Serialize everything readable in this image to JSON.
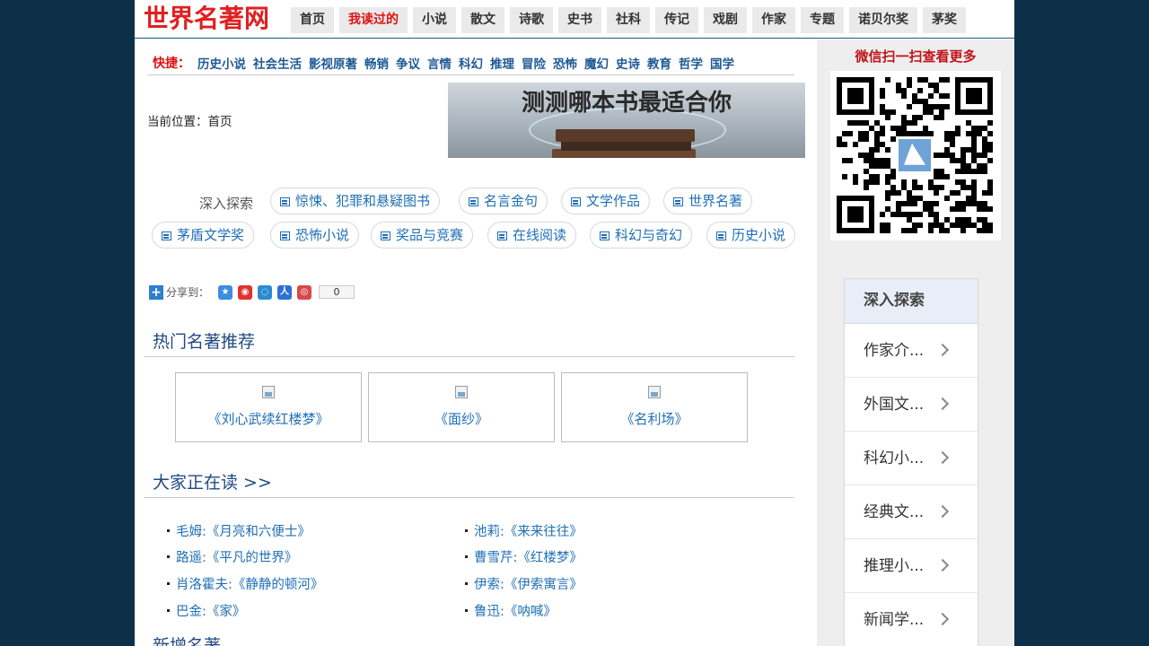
{
  "header": {
    "logo": "世界名著网",
    "nav": [
      {
        "label": "首页",
        "active": false
      },
      {
        "label": "我读过的",
        "active": true
      },
      {
        "label": "小说",
        "active": false
      },
      {
        "label": "散文",
        "active": false
      },
      {
        "label": "诗歌",
        "active": false
      },
      {
        "label": "史书",
        "active": false
      },
      {
        "label": "社科",
        "active": false
      },
      {
        "label": "传记",
        "active": false
      },
      {
        "label": "戏剧",
        "active": false
      },
      {
        "label": "作家",
        "active": false
      },
      {
        "label": "专题",
        "active": false
      },
      {
        "label": "诺贝尔奖",
        "active": false
      },
      {
        "label": "茅奖",
        "active": false
      }
    ]
  },
  "quick": {
    "label": "快捷：",
    "links": [
      "历史小说",
      "社会生活",
      "影视原著",
      "畅销",
      "争议",
      "言情",
      "科幻",
      "推理",
      "冒险",
      "恐怖",
      "魔幻",
      "史诗",
      "教育",
      "哲学",
      "国学"
    ]
  },
  "breadcrumb": "当前位置：首页",
  "banner": {
    "text": "测测哪本书最适合你"
  },
  "explore": {
    "label": "深入探索",
    "row1": [
      "惊悚、犯罪和悬疑图书",
      "名言金句",
      "文学作品",
      "世界名著"
    ],
    "row2": [
      "茅盾文学奖",
      "恐怖小说",
      "奖品与竞赛",
      "在线阅读",
      "科幻与奇幻",
      "历史小说"
    ]
  },
  "share": {
    "label": "分享到：",
    "count": "0"
  },
  "hot": {
    "title": "热门名著推荐",
    "books": [
      "《刘心武续红楼梦》",
      "《面纱》",
      "《名利场》"
    ]
  },
  "reading": {
    "title": "大家正在读 >>",
    "left": [
      "毛姆:《月亮和六便士》",
      "路遥:《平凡的世界》",
      "肖洛霍夫:《静静的顿河》",
      "巴金:《家》"
    ],
    "right": [
      "池莉:《来来往往》",
      "曹雪芹:《红楼梦》",
      "伊索:《伊索寓言》",
      "鲁迅:《呐喊》"
    ]
  },
  "new": {
    "title": "新增名著"
  },
  "sidebar": {
    "qr_title": "微信扫一扫查看更多",
    "panel_title": "深入探索",
    "items": [
      "作家介...",
      "外国文...",
      "科幻小...",
      "经典文...",
      "推理小...",
      "新闻学..."
    ]
  },
  "colors": {
    "accent_red": "#d11111",
    "link_blue": "#1f6fb5",
    "nav_bg": "#eaeaea",
    "page_bg": "#0d3049"
  }
}
